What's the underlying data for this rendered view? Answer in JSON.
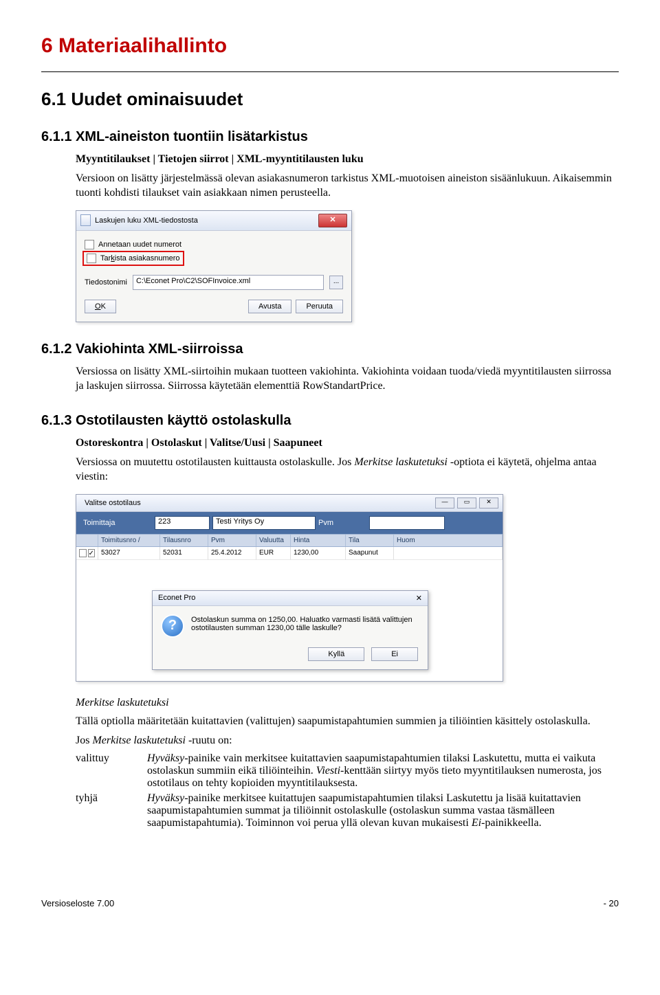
{
  "heading1": "6   Materiaalihallinto",
  "heading2": "6.1 Uudet ominaisuudet",
  "s611": {
    "title": "6.1.1 XML-aineiston tuontiin lisätarkistus",
    "breadcrumb": "Myyntitilaukset | Tietojen siirrot | XML-myyntitilausten luku",
    "p1": "Versioon on lisätty järjestelmässä olevan asiakasnumeron tarkistus XML-muotoisen aineiston sisäänlukuun. Aikaisemmin tuonti kohdisti tilaukset vain asiakkaan nimen perusteella."
  },
  "dialog1": {
    "title": "Laskujen luku XML-tiedostosta",
    "opt1": "Annetaan uudet numerot",
    "opt2": "Tarkista asiakasnumero",
    "file_label": "Tiedostonimi",
    "file_value": "C:\\Econet Pro\\C2\\SOFInvoice.xml",
    "ok": "OK",
    "help": "Avusta",
    "cancel": "Peruuta",
    "browse": "..."
  },
  "s612": {
    "title": "6.1.2 Vakiohinta XML-siirroissa",
    "p1": "Versiossa on lisätty XML-siirtoihin mukaan tuotteen vakiohinta. Vakiohinta voidaan tuoda/viedä myyntitilausten siirrossa ja laskujen siirrossa. Siirrossa käytetään elementtiä RowStandartPrice."
  },
  "s613": {
    "title": "6.1.3 Ostotilausten käyttö ostolaskulla",
    "breadcrumb": "Ostoreskontra | Ostolaskut | Valitse/Uusi | Saapuneet",
    "p1a": "Versiossa on muutettu ostotilausten kuittausta ostolaskulle. Jos ",
    "p1em": "Merkitse laskutetuksi",
    "p1b": " -optiota ei käytetä, ohjelma antaa viestin:"
  },
  "dialog2": {
    "wintitle": "Valitse ostotilaus",
    "supplier_lbl": "Toimittaja",
    "supplier_no": "223",
    "supplier_name": "Testi Yritys Oy",
    "date_lbl": "Pvm",
    "headers": [
      "",
      "Toimitusnro /",
      "Tilausnro",
      "Pvm",
      "Valuutta",
      "Hinta",
      "Tila",
      "Huom"
    ],
    "row": [
      "",
      "53027",
      "52031",
      "25.4.2012",
      "EUR",
      "1230,00",
      "Saapunut",
      ""
    ],
    "msg_title": "Econet Pro",
    "msg_text": "Ostolaskun summa on 1250,00. Haluatko varmasti lisätä valittujen ostotilausten summan 1230,00 tälle laskulle?",
    "yes": "Kyllä",
    "no": "Ei"
  },
  "after2": {
    "em1": "Merkitse laskutetuksi",
    "p2": "Tällä optiolla määritetään kuitattavien (valittujen) saapumistapahtumien summien ja tiliöintien käsittely ostolaskulla.",
    "p3a": "Jos ",
    "p3em": "Merkitse laskutetuksi",
    "p3b": " -ruutu on:",
    "rows": [
      {
        "term": "valittuy",
        "def_a": "",
        "def_em1": "Hyväksy",
        "def_b": "-painike vain merkitsee kuitattavien saapumistapahtumien tilaksi Laskutettu, mutta ei vaikuta ostolaskun summiin eikä tiliöinteihin. ",
        "def_em2": "Viesti",
        "def_c": "-kenttään siirtyy myös tieto myyntitilauksen numerosta, jos ostotilaus on tehty kopioiden myyntitilauksesta."
      },
      {
        "term": "tyhjä",
        "def_a": "",
        "def_em1": "Hyväksy",
        "def_b": "-painike merkitsee kuitattujen saapumistapahtumien tilaksi Laskutettu ja lisää kuitattavien saapumistapahtumien summat ja tiliöinnit ostolaskulle (ostolaskun summa vastaa täsmälleen saapumistapahtumia). Toiminnon voi perua yllä olevan kuvan mukaisesti ",
        "def_em2": "Ei",
        "def_c": "-painikkeella."
      }
    ]
  },
  "footer_left": "Versioseloste 7.00",
  "footer_right": "- 20"
}
